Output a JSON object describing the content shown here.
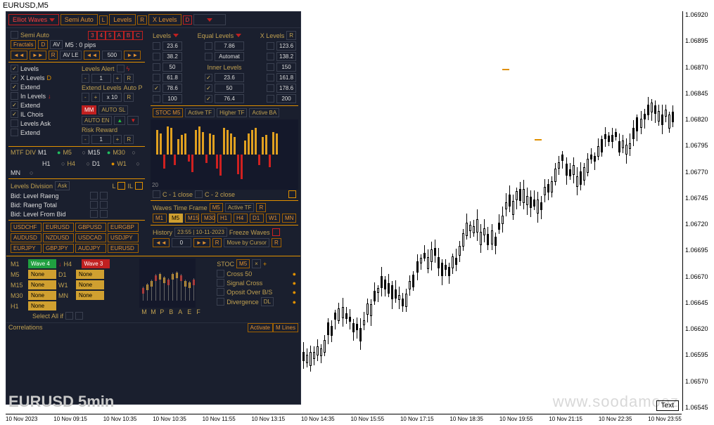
{
  "title": "EURUSD,M5",
  "toolbar": {
    "elliot": "Elliot Waves",
    "semiauto": "Semi Auto",
    "levels": "Levels",
    "xlevels": "X Levels",
    "indL": "L",
    "indR": "R",
    "indD": "D"
  },
  "semiauto_row": {
    "label": "Semi Auto",
    "nums": [
      "3",
      "4",
      "5",
      "A",
      "B",
      "C"
    ]
  },
  "fractals_row": {
    "fractals": "Fractals",
    "d": "D",
    "av": "AV",
    "m5pips": "M5 : 0  pips",
    "back": "◄◄",
    "fwd": "►►",
    "r": "R",
    "avle": "AV LE",
    "d2": "◄◄",
    "val": "500",
    "f2": "►►"
  },
  "levels_col": {
    "levels": "Levels",
    "xlevels": "X Levels",
    "extend": "Extend",
    "inlevels": "In Levels",
    "extend2": "Extend",
    "ilchois": "IL Chois",
    "levelsask": "Levels Ask",
    "extend3": "Extend",
    "d": "D",
    "down": "↓"
  },
  "alert_col": {
    "levelsalert": "Levels Alert",
    "minus": "-",
    "one1": "1",
    "plus": "+",
    "r": "R",
    "extendlevels": "Extend Levels",
    "autop": "Auto P",
    "x10": "x 10",
    "mm": "MM",
    "autosl": "AUTO SL",
    "autoen": "AUTO EN",
    "up": "▲",
    "down": "▼",
    "risk": "Risk Reward"
  },
  "levels_right": {
    "h1": "Levels",
    "h2": "Equal Levels",
    "h3": "X Levels",
    "r": "R",
    "v1": [
      "23.6",
      "38.2",
      "50",
      "61.8",
      "78.6",
      "100"
    ],
    "v2": [
      "7.86",
      "Automat",
      "",
      "23.6",
      "50",
      "76.4"
    ],
    "v2h": "Inner Levels",
    "v3": [
      "123.6",
      "138.2",
      "150",
      "161.8",
      "178.6",
      "200"
    ]
  },
  "stoc": {
    "h": "STOC M5",
    "active": "Active TF",
    "higher": "Higher TF",
    "activeba": "Active BA",
    "y20": "20"
  },
  "cclose": {
    "c1": "C - 1 close",
    "c2": "C - 2 close",
    "box": ""
  },
  "mtf": {
    "label": "MTF DIV",
    "tfs": [
      "M1",
      "M5",
      "M15",
      "M30",
      "H1",
      "H4",
      "D1",
      "W1",
      "MN"
    ],
    "dots": [
      "●",
      "○",
      "●",
      "○",
      "○",
      "○",
      "●",
      "○",
      "○"
    ]
  },
  "division": {
    "label": "Levels Division",
    "ask": "Ask",
    "l": "L",
    "il": "IL",
    "bids": [
      "Bid: Level Raeng",
      "Bid: Raeng Total",
      "Bid: Level From Bid"
    ]
  },
  "pairs": [
    "USDCHF",
    "EURUSD",
    "GBPUSD",
    "EURGBP",
    "AUDUSD",
    "NZDUSD",
    "USDCAD",
    "USDJPY",
    "EURJPY",
    "GBPJPY",
    "AUDJPY",
    "EURUSD"
  ],
  "wtf": {
    "label": "Waves Time Frame",
    "m5": "M5",
    "active": "Active TF",
    "r": "R",
    "tfs": [
      "M1",
      "M5",
      "M15",
      "M30",
      "H1",
      "H4",
      "D1",
      "W1",
      "MN"
    ]
  },
  "history": {
    "label": "History",
    "time": "23:55 | 10-11-2023",
    "freeze": "Freeze Waves",
    "back": "◄◄",
    "zero": "0",
    "fwd": "►►",
    "r": "R",
    "cursor": "Move by Cursor",
    "r2": "R"
  },
  "waves_grid": {
    "tfs": [
      "M1",
      "M5",
      "M15",
      "M30",
      "H1"
    ],
    "vals": [
      "Wave 4",
      "None",
      "None",
      "None",
      "None"
    ],
    "tfs2": [
      "H4",
      "D1",
      "W1",
      "MN",
      ""
    ],
    "vals2": [
      "Wave 3",
      "None",
      "None",
      "None",
      ""
    ],
    "selectall": "Select All if",
    "down": "↓"
  },
  "mmpbaef": [
    "M",
    "M",
    "P",
    "B",
    "A",
    "E",
    "F"
  ],
  "stoc2": {
    "label": "STOC",
    "m5": "M5",
    "x": "×",
    "plus": "+",
    "items": [
      "Cross 50",
      "Signal Cross",
      "Oposit Over B/S",
      "Divergence"
    ],
    "dl": "DL"
  },
  "footer": {
    "corr": "Correlations",
    "act": "Activate",
    "ml": "M Lines"
  },
  "symlabel": "EURUSD   5min",
  "watermark": "www.soodamooz",
  "textbtn": "Text",
  "yaxis": [
    "1.06920",
    "1.06895",
    "1.06870",
    "1.06845",
    "1.06820",
    "1.06795",
    "1.06770",
    "1.06745",
    "1.06720",
    "1.06695",
    "1.06670",
    "1.06645",
    "1.06620",
    "1.06595",
    "1.06570",
    "1.06545"
  ],
  "xaxis": [
    "10 Nov 2023",
    "10 Nov 09:15",
    "10 Nov 10:35",
    "10 Nov 10:35",
    "10 Nov 11:55",
    "10 Nov 13:15",
    "10 Nov 14:35",
    "10 Nov 15:55",
    "10 Nov 17:15",
    "10 Nov 18:35",
    "10 Nov 19:55",
    "10 Nov 21:15",
    "10 Nov 22:35",
    "10 Nov 23:55"
  ]
}
